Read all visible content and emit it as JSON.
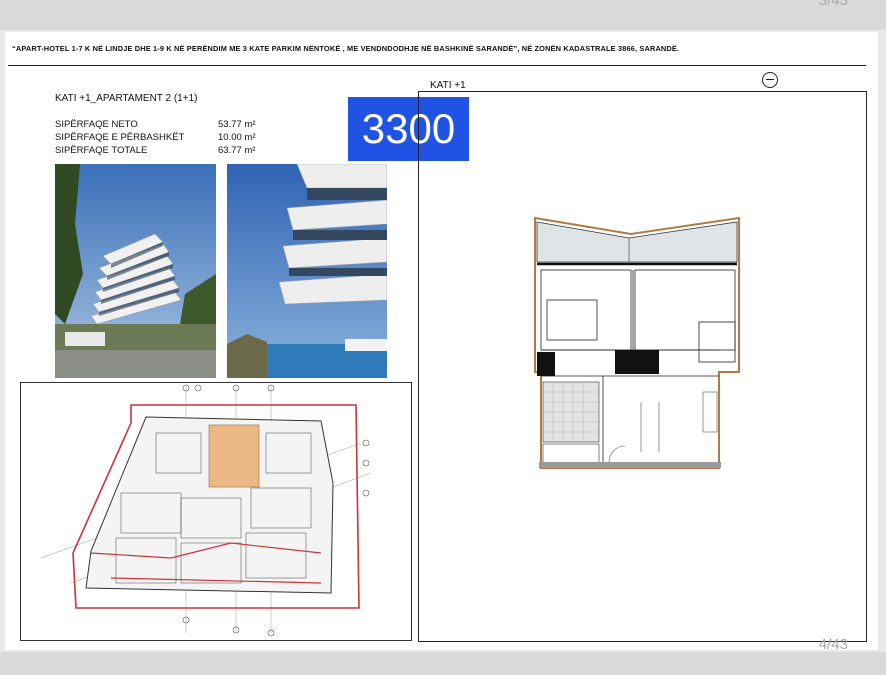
{
  "page_counter_top": "3/43",
  "page_counter_bottom": "4/43",
  "header_text": "“APART-HOTEL 1-7 K NË LINDJE DHE 1-9 K NË PERËNDIM ME 3 KATE PARKIM NËNTOKË , ME VENDNDODHJE NË BASHKINË SARANDË”, NË ZONËN KADASTRALE 3866, SARANDË.",
  "apartment_title": "KATI +1_APARTAMENT 2  (1+1)",
  "areas": [
    {
      "label": "SIPËRFAQE NETO",
      "value": "53.77 m²"
    },
    {
      "label": "SIPËRFAQE E PËRBASHKËT",
      "value": "10.00 m²"
    },
    {
      "label": "SIPËRFAQE TOTALE",
      "value": "63.77 m²"
    }
  ],
  "badge_value": "3300",
  "floor_label": "KATI +1",
  "colors": {
    "badge": "#2152e6",
    "highlight": "#e9b884",
    "site_red": "#c8343c"
  }
}
